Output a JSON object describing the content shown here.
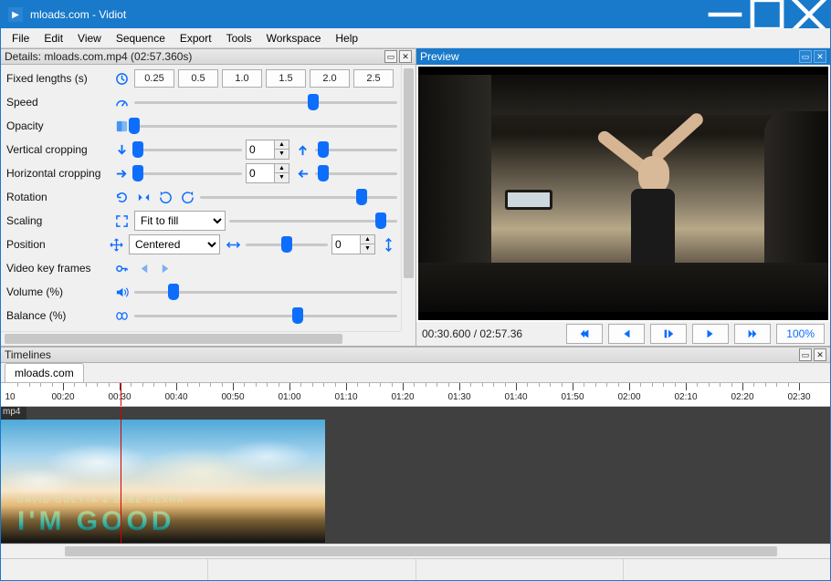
{
  "window": {
    "title": "mloads.com - Vidiot"
  },
  "menu": [
    "File",
    "Edit",
    "View",
    "Sequence",
    "Export",
    "Tools",
    "Workspace",
    "Help"
  ],
  "details": {
    "title": "Details: mloads.com.mp4 (02:57.360s)",
    "fixed_lengths_label": "Fixed lengths (s)",
    "length_buttons": [
      "0.25",
      "0.5",
      "1.0",
      "1.5",
      "2.0",
      "2.5"
    ],
    "speed_label": "Speed",
    "opacity_label": "Opacity",
    "vcrop_label": "Vertical cropping",
    "vcrop_value": "0",
    "hcrop_label": "Horizontal cropping",
    "hcrop_value": "0",
    "rotation_label": "Rotation",
    "scaling_label": "Scaling",
    "scaling_mode": "Fit to fill",
    "position_label": "Position",
    "position_mode": "Centered",
    "position_value": "0",
    "keyframes_label": "Video key frames",
    "volume_label": "Volume (%)",
    "balance_label": "Balance (%)"
  },
  "preview": {
    "title": "Preview",
    "timecode": "00:30.600 / 02:57.36",
    "zoom": "100%"
  },
  "timelines": {
    "title": "Timelines",
    "tab": "mloads.com",
    "track_label": "mp4",
    "ruler_start_label": "10",
    "markers": [
      "00:20",
      "00:30",
      "00:40",
      "00:50",
      "01:00",
      "01:10",
      "01:20",
      "01:30",
      "01:40",
      "01:50",
      "02:00",
      "02:10",
      "02:20",
      "02:30"
    ],
    "clip_subtitle": "DAVID GUETTA & BEBE REXHA",
    "clip_title": "I'M GOOD",
    "playhead_time": "00:30"
  }
}
